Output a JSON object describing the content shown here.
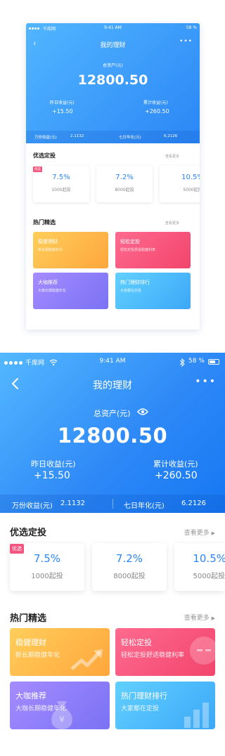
{
  "status": {
    "carrier": "千库网",
    "time": "9:41 AM",
    "battery": "58 %"
  },
  "header": {
    "title": "我的理财",
    "total_label": "总资产(元)",
    "total_value": "12800.50",
    "yesterday_label": "昨日收益(元)",
    "yesterday_value": "+15.50",
    "cumulative_label": "累计收益(元)",
    "cumulative_value": "+260.50",
    "wanfen_label": "万份收益(元)",
    "wanfen_value": "2.1132",
    "seven_day_label": "七日年化(元)",
    "seven_day_value": "6.2126"
  },
  "featured": {
    "title": "优选定投",
    "see_more": "查看更多",
    "tag": "优选",
    "items": [
      {
        "rate": "7.5%",
        "min": "1000起投"
      },
      {
        "rate": "7.2%",
        "min": "8000起投"
      },
      {
        "rate": "10.5%",
        "min": "5000起投"
      }
    ]
  },
  "hot": {
    "title": "热门精选",
    "see_more": "查看更多",
    "tiles": [
      {
        "title": "稳健理财",
        "desc": "新长期稳健年化",
        "color": "#ffb84a",
        "icon": "trend-up-icon"
      },
      {
        "title": "轻松定投",
        "desc": "轻松定投舒适稳健利率",
        "color": "#f7557c",
        "icon": "face-bubble-icon"
      },
      {
        "title": "大咖推荐",
        "desc": "大咖长期稳健年化",
        "color": "#8b7ef8",
        "icon": "money-bag-icon"
      },
      {
        "title": "热门理财排行",
        "desc": "大家都在定投",
        "color": "#49b8fa",
        "icon": "bar-chart-icon"
      }
    ]
  },
  "icons": {
    "back": "back-chevron-icon",
    "more": "more-dots-icon",
    "eye": "eye-icon",
    "bluetooth": "bluetooth-icon",
    "wifi": "wifi-icon"
  },
  "colors": {
    "accent": "#2a86f6",
    "tag": "#f2557e"
  }
}
